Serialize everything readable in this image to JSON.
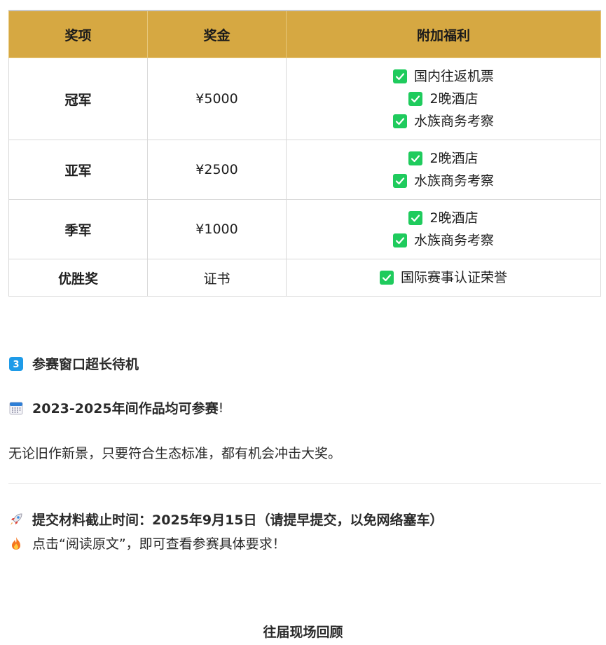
{
  "table": {
    "headers": [
      "奖项",
      "奖金",
      "附加福利"
    ],
    "rows": [
      {
        "award": "冠军",
        "prize": "¥5000",
        "benefits": [
          "国内往返机票",
          "2晚酒店",
          "水族商务考察"
        ]
      },
      {
        "award": "亚军",
        "prize": "¥2500",
        "benefits": [
          "2晚酒店",
          "水族商务考察"
        ]
      },
      {
        "award": "季军",
        "prize": "¥1000",
        "benefits": [
          "2晚酒店",
          "水族商务考察"
        ]
      },
      {
        "award": "优胜奖",
        "prize": "证书",
        "benefits": [
          "国际赛事认证荣誉"
        ]
      }
    ]
  },
  "section3": {
    "badge": "3",
    "title": "参赛窗口超长待机"
  },
  "calendar_line": {
    "bold": "2023-2025年间作品均可参赛",
    "suffix": "!"
  },
  "paragraph": "无论旧作新景，只要符合生态标准，都有机会冲击大奖。",
  "deadline": "提交材料截止时间：2025年9月15日（请提早提交，以免网络塞车）",
  "read_more": "点击“阅读原文”，即可查看参赛具体要求！",
  "review_title": "往届现场回顾",
  "colors": {
    "header_bg": "#d6a842",
    "check_green": "#1fcb5d",
    "badge_blue": "#1e9be8"
  },
  "icons": {
    "badge": "keycap-3-icon",
    "calendar": "calendar-icon",
    "rocket": "rocket-icon",
    "fire": "fire-icon",
    "check": "check-box-icon"
  }
}
